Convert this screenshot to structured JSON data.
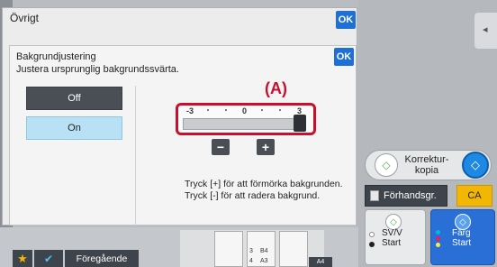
{
  "dialog": {
    "outer_title": "Övrigt",
    "ok_label": "OK",
    "inner_title": "Bakgrundjustering",
    "inner_subtitle": "Justera ursprunglig bakgrundssvärta.",
    "inner_ok_label": "OK"
  },
  "options": {
    "off_label": "Off",
    "on_label": "On",
    "selected": "On"
  },
  "annotation_label": "(A)",
  "slider": {
    "min_label": "-3",
    "mid_label": "0",
    "max_label": "3",
    "value": 3,
    "minus_label": "−",
    "plus_label": "+"
  },
  "help": {
    "line1": "Tryck [+] för att förmörka bakgrunden.",
    "line2": "Tryck [-] för att radera bakgrund."
  },
  "right_panel": {
    "proof_label": "Korrektur-\nkopia",
    "preview_label": "Förhandsgr.",
    "ca_label": "CA",
    "bw_label_1": "SV/V",
    "bw_label_2": "Start",
    "color_label_1": "Färg",
    "color_label_2": "Start",
    "side_tab_icon": "chevron-left-icon"
  },
  "bottom_bar": {
    "previous_label": "Föregående",
    "star_icon": "star-icon",
    "check_icon": "check-icon",
    "paper_b4": "B4",
    "paper_a3": "A3",
    "paper_num3": "3",
    "paper_num4": "4",
    "paper_a4": "A4"
  },
  "colors": {
    "accent_blue": "#1e6fd6",
    "highlight_red": "#c8102e",
    "selected_option": "#b9e1f6",
    "ca_yellow": "#f2b705"
  }
}
